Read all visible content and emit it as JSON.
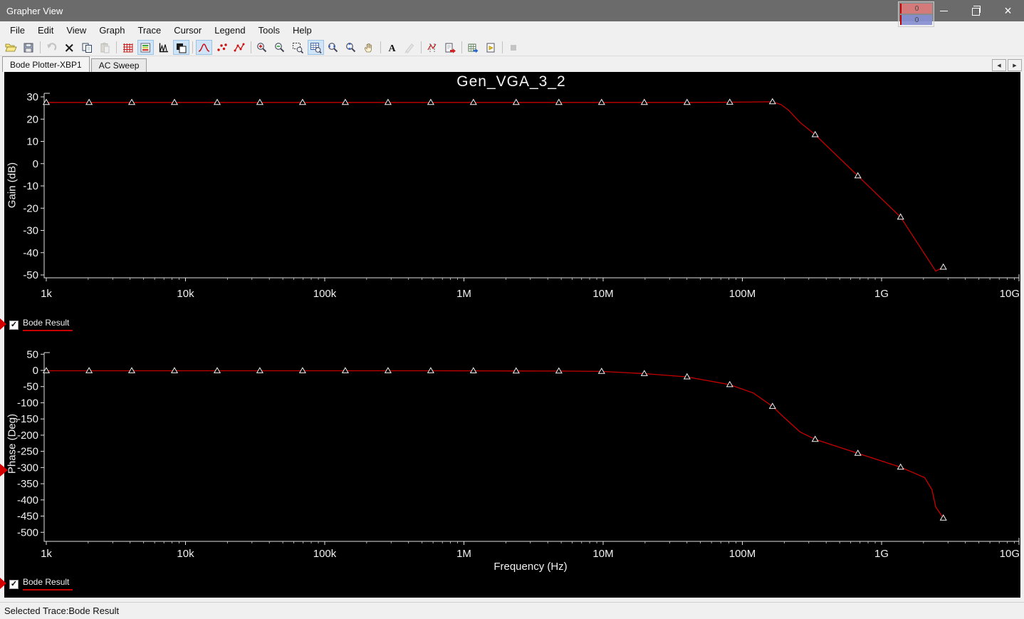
{
  "window": {
    "title": "Grapher View",
    "controls": {
      "minimize": "minimize",
      "restore": "restore",
      "close": "close"
    }
  },
  "title_bar_overlay": {
    "rows": [
      {
        "label": "0"
      },
      {
        "label": "0"
      }
    ]
  },
  "menu": {
    "items": [
      "File",
      "Edit",
      "View",
      "Graph",
      "Trace",
      "Cursor",
      "Legend",
      "Tools",
      "Help"
    ]
  },
  "toolbar": {
    "items": [
      {
        "name": "open-file-button",
        "icon": "open"
      },
      {
        "name": "save-button",
        "icon": "save"
      },
      {
        "type": "sep"
      },
      {
        "name": "undo-button",
        "icon": "undo",
        "disabled": true
      },
      {
        "name": "delete-button",
        "icon": "delete"
      },
      {
        "name": "copy-button",
        "icon": "copy"
      },
      {
        "name": "paste-button",
        "icon": "paste",
        "disabled": true
      },
      {
        "type": "sep"
      },
      {
        "name": "show-grid-button",
        "icon": "grid"
      },
      {
        "name": "show-legend-button",
        "icon": "legend",
        "active": true
      },
      {
        "name": "graph-properties-button",
        "icon": "axes"
      },
      {
        "name": "overlay-traces-button",
        "icon": "overlay",
        "active": true
      },
      {
        "type": "sep"
      },
      {
        "name": "line-plot-button",
        "icon": "line",
        "active": true
      },
      {
        "name": "scatter-plot-button",
        "icon": "scatter"
      },
      {
        "name": "line-points-plot-button",
        "icon": "linepts"
      },
      {
        "type": "sep"
      },
      {
        "name": "zoom-in-button",
        "icon": "zoom-in"
      },
      {
        "name": "zoom-out-button",
        "icon": "zoom-out"
      },
      {
        "name": "zoom-area-button",
        "icon": "zoom-area"
      },
      {
        "name": "zoom-fit-button",
        "icon": "zoom-fit",
        "active": true
      },
      {
        "name": "zoom-horizontal-button",
        "icon": "zoom-x"
      },
      {
        "name": "zoom-vertical-button",
        "icon": "zoom-y"
      },
      {
        "name": "pan-button",
        "icon": "pan"
      },
      {
        "type": "sep"
      },
      {
        "name": "add-text-button",
        "icon": "text"
      },
      {
        "name": "edit-annotation-button",
        "icon": "edit",
        "disabled": true
      },
      {
        "type": "sep"
      },
      {
        "name": "show-cursors-button",
        "icon": "cursors"
      },
      {
        "name": "export-graph-button",
        "icon": "export"
      },
      {
        "type": "sep"
      },
      {
        "name": "export-excel-button",
        "icon": "excel"
      },
      {
        "name": "export-labview-button",
        "icon": "labview"
      },
      {
        "type": "sep"
      },
      {
        "name": "stop-button",
        "icon": "stop",
        "disabled": true
      }
    ]
  },
  "tabs": {
    "items": [
      {
        "label": "Bode Plotter-XBP1",
        "active": true
      },
      {
        "label": "AC Sweep",
        "active": false
      }
    ]
  },
  "legend_rows": [
    {
      "label": "Bode Result",
      "checked": true,
      "check_glyph": "✓",
      "color": "#c80000"
    },
    {
      "label": "Bode Result",
      "checked": true,
      "check_glyph": "✓",
      "color": "#c80000"
    }
  ],
  "status_bar": {
    "text": "Selected Trace:Bode Result"
  },
  "colors": {
    "trace": "#c80000",
    "plot_background": "#000000",
    "axis_text": "#f0f0f0",
    "titlebar": "#6b6b6b",
    "chrome": "#f0f0f0",
    "active_tool_highlight": "#cfe4f7",
    "selection_pointer": "#d40000"
  },
  "chart_data": [
    {
      "type": "line",
      "title": "Gen_VGA_3_2",
      "ylabel": "Gain (dB)",
      "xlabel": "",
      "x_scale": "log",
      "xlim": [
        1000,
        10000000000
      ],
      "ylim": [
        -52,
        32
      ],
      "grid": false,
      "legend_position": "below-left",
      "x_ticks": [
        {
          "value": 1000,
          "label": "1k"
        },
        {
          "value": 10000,
          "label": "10k"
        },
        {
          "value": 100000,
          "label": "100k"
        },
        {
          "value": 1000000,
          "label": "1M"
        },
        {
          "value": 10000000,
          "label": "10M"
        },
        {
          "value": 100000000,
          "label": "100M"
        },
        {
          "value": 1000000000,
          "label": "1G"
        },
        {
          "value": 10000000000,
          "label": "10G"
        }
      ],
      "y_ticks": [
        30,
        20,
        10,
        0,
        -10,
        -20,
        -30,
        -40,
        -50
      ],
      "series": [
        {
          "name": "Bode Result",
          "color": "#c80000",
          "marker": "triangle",
          "points": [
            [
              1000,
              27.5
            ],
            [
              2030,
              27.5
            ],
            [
              4110,
              27.5
            ],
            [
              8330,
              27.5
            ],
            [
              16880,
              27.5
            ],
            [
              34200,
              27.5
            ],
            [
              69300,
              27.5
            ],
            [
              140500,
              27.5
            ],
            [
              284800,
              27.5
            ],
            [
              577400,
              27.5
            ],
            [
              1170000,
              27.5
            ],
            [
              2372000,
              27.5
            ],
            [
              4808000,
              27.5
            ],
            [
              9746000,
              27.5
            ],
            [
              19750000,
              27.5
            ],
            [
              40040000,
              27.5
            ],
            [
              81150000,
              27.6
            ],
            [
              164500000,
              27.8
            ],
            [
              333400000,
              13.0
            ],
            [
              675800000,
              -5.5
            ],
            [
              1370000000,
              -24.0
            ],
            [
              2776000000,
              -46.5
            ]
          ],
          "curve_extra": [
            [
              190000000,
              26.5
            ],
            [
              215000000,
              24.0
            ],
            [
              260000000,
              18.5
            ],
            [
              2450000000,
              -48.3
            ]
          ]
        }
      ]
    },
    {
      "type": "line",
      "title": "",
      "ylabel": "Phase (Deg)",
      "xlabel": "Frequency (Hz)",
      "x_scale": "log",
      "xlim": [
        1000,
        10000000000
      ],
      "ylim": [
        -510,
        55
      ],
      "grid": false,
      "legend_position": "below-left",
      "x_ticks": [
        {
          "value": 1000,
          "label": "1k"
        },
        {
          "value": 10000,
          "label": "10k"
        },
        {
          "value": 100000,
          "label": "100k"
        },
        {
          "value": 1000000,
          "label": "1M"
        },
        {
          "value": 10000000,
          "label": "10M"
        },
        {
          "value": 100000000,
          "label": "100M"
        },
        {
          "value": 1000000000,
          "label": "1G"
        },
        {
          "value": 10000000000,
          "label": "10G"
        }
      ],
      "y_ticks": [
        50,
        0,
        -50,
        -100,
        -150,
        -200,
        -250,
        -300,
        -350,
        -400,
        -450,
        -500
      ],
      "series": [
        {
          "name": "Bode Result",
          "color": "#c80000",
          "marker": "triangle",
          "points": [
            [
              1000,
              -1
            ],
            [
              2030,
              -1
            ],
            [
              4110,
              -1
            ],
            [
              8330,
              -1
            ],
            [
              16880,
              -1
            ],
            [
              34200,
              -1
            ],
            [
              69300,
              -1
            ],
            [
              140500,
              -1
            ],
            [
              284800,
              -1
            ],
            [
              577400,
              -1.2
            ],
            [
              1170000,
              -1.4
            ],
            [
              2372000,
              -1.7
            ],
            [
              4808000,
              -2
            ],
            [
              9746000,
              -3
            ],
            [
              19750000,
              -10
            ],
            [
              40040000,
              -20
            ],
            [
              81150000,
              -44
            ],
            [
              164500000,
              -111
            ],
            [
              333400000,
              -213
            ],
            [
              675800000,
              -256
            ],
            [
              1370000000,
              -299
            ],
            [
              2776000000,
              -456
            ]
          ],
          "curve_extra": [
            [
              120000000,
              -70
            ],
            [
              200000000,
              -146
            ],
            [
              260000000,
              -190
            ],
            [
              2040000000,
              -331
            ],
            [
              2300000000,
              -368
            ],
            [
              2450000000,
              -422
            ]
          ]
        }
      ]
    }
  ]
}
